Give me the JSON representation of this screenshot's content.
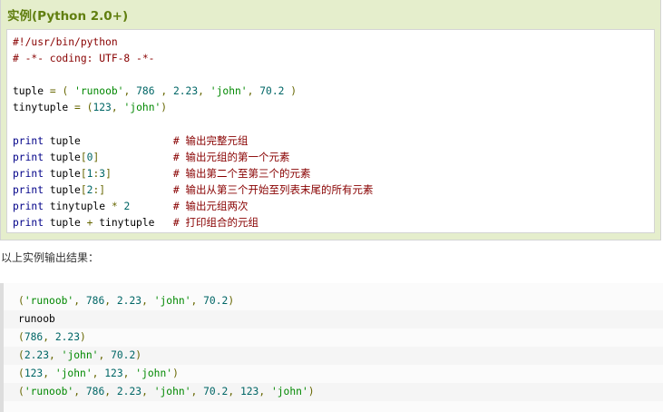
{
  "example": {
    "title": "实例(Python 2.0+)",
    "code_lines": [
      [
        {
          "t": "#!/usr/bin/python",
          "c": "comment"
        }
      ],
      [
        {
          "t": "# -*- coding: UTF-8 -*-",
          "c": "comment"
        }
      ],
      [],
      [
        {
          "t": "tuple ",
          "c": "plain"
        },
        {
          "t": "=",
          "c": "pun"
        },
        {
          "t": " ",
          "c": "plain"
        },
        {
          "t": "(",
          "c": "pun"
        },
        {
          "t": " ",
          "c": "plain"
        },
        {
          "t": "'runoob'",
          "c": "str"
        },
        {
          "t": ",",
          "c": "pun"
        },
        {
          "t": " ",
          "c": "plain"
        },
        {
          "t": "786",
          "c": "num"
        },
        {
          "t": " ",
          "c": "plain"
        },
        {
          "t": ",",
          "c": "pun"
        },
        {
          "t": " ",
          "c": "plain"
        },
        {
          "t": "2.23",
          "c": "num"
        },
        {
          "t": ",",
          "c": "pun"
        },
        {
          "t": " ",
          "c": "plain"
        },
        {
          "t": "'john'",
          "c": "str"
        },
        {
          "t": ",",
          "c": "pun"
        },
        {
          "t": " ",
          "c": "plain"
        },
        {
          "t": "70.2",
          "c": "num"
        },
        {
          "t": " ",
          "c": "plain"
        },
        {
          "t": ")",
          "c": "pun"
        }
      ],
      [
        {
          "t": "tinytuple ",
          "c": "plain"
        },
        {
          "t": "=",
          "c": "pun"
        },
        {
          "t": " ",
          "c": "plain"
        },
        {
          "t": "(",
          "c": "pun"
        },
        {
          "t": "123",
          "c": "num"
        },
        {
          "t": ",",
          "c": "pun"
        },
        {
          "t": " ",
          "c": "plain"
        },
        {
          "t": "'john'",
          "c": "str"
        },
        {
          "t": ")",
          "c": "pun"
        }
      ],
      [],
      [
        {
          "t": "print",
          "c": "kw"
        },
        {
          "t": " tuple               ",
          "c": "plain"
        },
        {
          "t": "# ",
          "c": "comment"
        },
        {
          "t": "输出完整元组",
          "c": "comment-cn"
        }
      ],
      [
        {
          "t": "print",
          "c": "kw"
        },
        {
          "t": " tuple",
          "c": "plain"
        },
        {
          "t": "[",
          "c": "pun"
        },
        {
          "t": "0",
          "c": "num"
        },
        {
          "t": "]",
          "c": "pun"
        },
        {
          "t": "            ",
          "c": "plain"
        },
        {
          "t": "# ",
          "c": "comment"
        },
        {
          "t": "输出元组的第一个元素",
          "c": "comment-cn"
        }
      ],
      [
        {
          "t": "print",
          "c": "kw"
        },
        {
          "t": " tuple",
          "c": "plain"
        },
        {
          "t": "[",
          "c": "pun"
        },
        {
          "t": "1",
          "c": "num"
        },
        {
          "t": ":",
          "c": "pun"
        },
        {
          "t": "3",
          "c": "num"
        },
        {
          "t": "]",
          "c": "pun"
        },
        {
          "t": "          ",
          "c": "plain"
        },
        {
          "t": "# ",
          "c": "comment"
        },
        {
          "t": "输出第二个至第三个的元素",
          "c": "comment-cn"
        }
      ],
      [
        {
          "t": "print",
          "c": "kw"
        },
        {
          "t": " tuple",
          "c": "plain"
        },
        {
          "t": "[",
          "c": "pun"
        },
        {
          "t": "2",
          "c": "num"
        },
        {
          "t": ":]",
          "c": "pun"
        },
        {
          "t": "           ",
          "c": "plain"
        },
        {
          "t": "# ",
          "c": "comment"
        },
        {
          "t": "输出从第三个开始至列表末尾的所有元素",
          "c": "comment-cn"
        }
      ],
      [
        {
          "t": "print",
          "c": "kw"
        },
        {
          "t": " tinytuple ",
          "c": "plain"
        },
        {
          "t": "*",
          "c": "pun"
        },
        {
          "t": " ",
          "c": "plain"
        },
        {
          "t": "2",
          "c": "num"
        },
        {
          "t": "       ",
          "c": "plain"
        },
        {
          "t": "# ",
          "c": "comment"
        },
        {
          "t": "输出元组两次",
          "c": "comment-cn"
        }
      ],
      [
        {
          "t": "print",
          "c": "kw"
        },
        {
          "t": " tuple ",
          "c": "plain"
        },
        {
          "t": "+",
          "c": "pun"
        },
        {
          "t": " tinytuple   ",
          "c": "plain"
        },
        {
          "t": "# ",
          "c": "comment"
        },
        {
          "t": "打印组合的元组",
          "c": "comment-cn"
        }
      ]
    ]
  },
  "output_intro": "以上实例输出结果：",
  "output_lines": [
    [
      {
        "t": "(",
        "c": "pun"
      },
      {
        "t": "'runoob'",
        "c": "str"
      },
      {
        "t": ", ",
        "c": "pun"
      },
      {
        "t": "786",
        "c": "num"
      },
      {
        "t": ", ",
        "c": "pun"
      },
      {
        "t": "2.23",
        "c": "num"
      },
      {
        "t": ", ",
        "c": "pun"
      },
      {
        "t": "'john'",
        "c": "str"
      },
      {
        "t": ", ",
        "c": "pun"
      },
      {
        "t": "70.2",
        "c": "num"
      },
      {
        "t": ")",
        "c": "pun"
      }
    ],
    [
      {
        "t": "runoob",
        "c": "plain"
      }
    ],
    [
      {
        "t": "(",
        "c": "pun"
      },
      {
        "t": "786",
        "c": "num"
      },
      {
        "t": ", ",
        "c": "pun"
      },
      {
        "t": "2.23",
        "c": "num"
      },
      {
        "t": ")",
        "c": "pun"
      }
    ],
    [
      {
        "t": "(",
        "c": "pun"
      },
      {
        "t": "2.23",
        "c": "num"
      },
      {
        "t": ", ",
        "c": "pun"
      },
      {
        "t": "'john'",
        "c": "str"
      },
      {
        "t": ", ",
        "c": "pun"
      },
      {
        "t": "70.2",
        "c": "num"
      },
      {
        "t": ")",
        "c": "pun"
      }
    ],
    [
      {
        "t": "(",
        "c": "pun"
      },
      {
        "t": "123",
        "c": "num"
      },
      {
        "t": ", ",
        "c": "pun"
      },
      {
        "t": "'john'",
        "c": "str"
      },
      {
        "t": ", ",
        "c": "pun"
      },
      {
        "t": "123",
        "c": "num"
      },
      {
        "t": ", ",
        "c": "pun"
      },
      {
        "t": "'john'",
        "c": "str"
      },
      {
        "t": ")",
        "c": "pun"
      }
    ],
    [
      {
        "t": "(",
        "c": "pun"
      },
      {
        "t": "'runoob'",
        "c": "str"
      },
      {
        "t": ", ",
        "c": "pun"
      },
      {
        "t": "786",
        "c": "num"
      },
      {
        "t": ", ",
        "c": "pun"
      },
      {
        "t": "2.23",
        "c": "num"
      },
      {
        "t": ", ",
        "c": "pun"
      },
      {
        "t": "'john'",
        "c": "str"
      },
      {
        "t": ", ",
        "c": "pun"
      },
      {
        "t": "70.2",
        "c": "num"
      },
      {
        "t": ", ",
        "c": "pun"
      },
      {
        "t": "123",
        "c": "num"
      },
      {
        "t": ", ",
        "c": "pun"
      },
      {
        "t": "'john'",
        "c": "str"
      },
      {
        "t": ")",
        "c": "pun"
      }
    ]
  ],
  "colors": {
    "title_green": "#617f10",
    "example_bg": "#e5eecc",
    "comment": "#880000",
    "keyword": "#000088",
    "number": "#006666",
    "string": "#008800",
    "punctuation": "#666600"
  }
}
